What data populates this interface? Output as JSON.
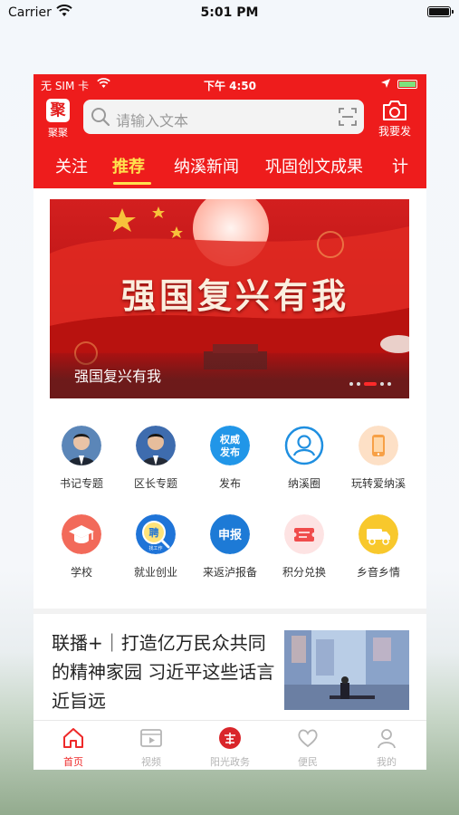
{
  "ios_status": {
    "carrier": "Carrier",
    "time": "5:01 PM"
  },
  "inner_status": {
    "carrier": "无 SIM 卡",
    "time": "下午 4:50"
  },
  "header": {
    "logo_char": "聚",
    "logo_label": "聚聚",
    "search_placeholder": "请输入文本",
    "post_label": "我要发"
  },
  "tabs": [
    {
      "label": "关注",
      "active": false
    },
    {
      "label": "推荐",
      "active": true
    },
    {
      "label": "纳溪新闻",
      "active": false
    },
    {
      "label": "巩固创文成果",
      "active": false
    },
    {
      "label": "计",
      "active": false
    }
  ],
  "banner": {
    "title": "强国复兴有我",
    "caption": "强国复兴有我",
    "active_slide": 3,
    "slide_count": 5
  },
  "grid": {
    "row1": [
      {
        "label": "书记专题",
        "icon": "portrait-icon"
      },
      {
        "label": "区长专题",
        "icon": "portrait-icon"
      },
      {
        "label": "发布",
        "icon": "release-icon",
        "icon_text": [
          "权威",
          "发布"
        ]
      },
      {
        "label": "纳溪圈",
        "icon": "circle-user-icon"
      },
      {
        "label": "玩转爱纳溪",
        "icon": "phone-icon"
      }
    ],
    "row2": [
      {
        "label": "学校",
        "icon": "graduation-cap-icon"
      },
      {
        "label": "就业创业",
        "icon": "recruit-icon",
        "icon_text": [
          "聘",
          "找工作"
        ]
      },
      {
        "label": "来返泸报备",
        "icon": "report-icon",
        "icon_text": [
          "申报"
        ]
      },
      {
        "label": "积分兑换",
        "icon": "ticket-icon"
      },
      {
        "label": "乡音乡情",
        "icon": "truck-icon"
      }
    ]
  },
  "news": {
    "headline": "联播+｜打造亿万民众共同的精神家园 习近平这些话言近旨远"
  },
  "bottom_nav": [
    {
      "label": "首页",
      "icon": "home-icon",
      "active": true
    },
    {
      "label": "视频",
      "icon": "video-icon",
      "active": false
    },
    {
      "label": "阳光政务",
      "icon": "government-icon",
      "active": false
    },
    {
      "label": "便民",
      "icon": "heart-icon",
      "active": false
    },
    {
      "label": "我的",
      "icon": "user-icon",
      "active": false
    }
  ],
  "colors": {
    "brand_red": "#ee1c1c",
    "active_tab": "#ffe14d",
    "nav_active": "#ee2a2a"
  }
}
